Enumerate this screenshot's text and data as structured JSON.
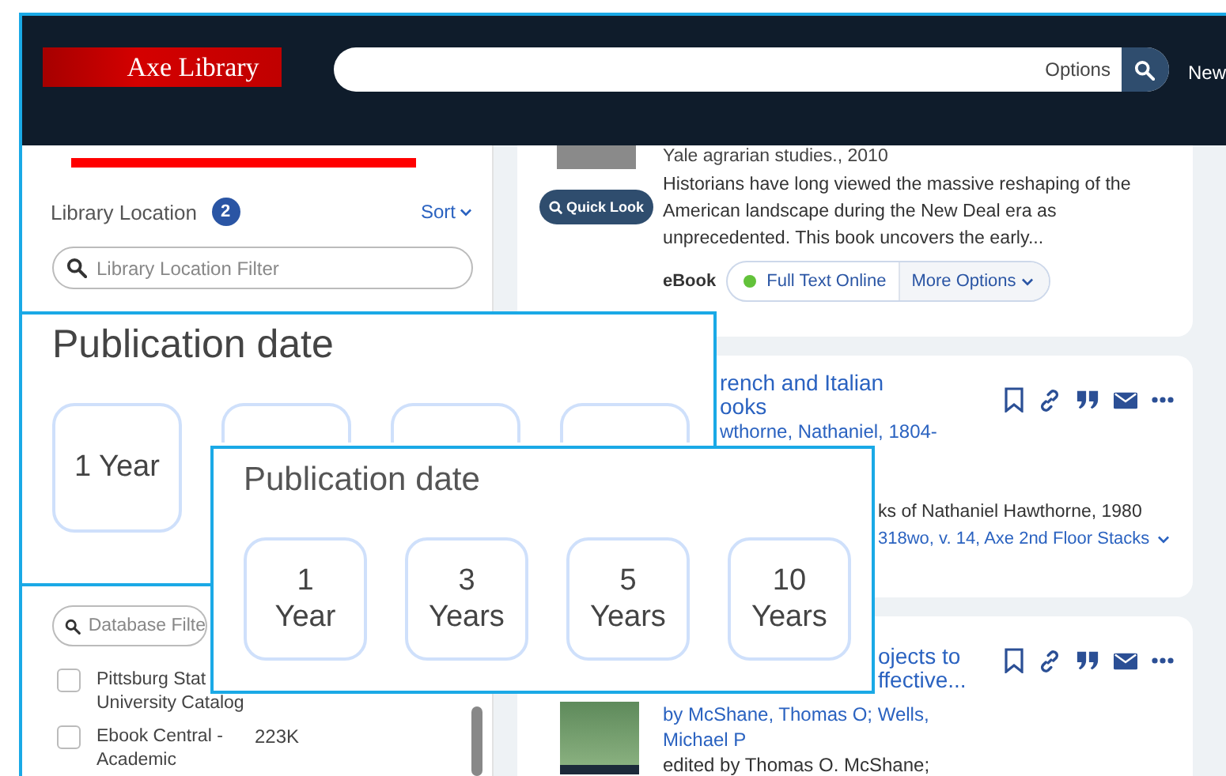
{
  "header": {
    "logo": "Axe Library",
    "search": {
      "options_label": "Options"
    },
    "nav_link": "New"
  },
  "sidebar": {
    "location_facet": {
      "title": "Library Location",
      "count": "2",
      "sort": "Sort",
      "filter_placeholder": "Library Location Filter"
    },
    "database_facet": {
      "filter_placeholder": "Database Filte",
      "items": [
        {
          "label": "Pittsburg Stat\nUniversity Catalog",
          "checked": false
        },
        {
          "label": "Ebook Central -\nAcademic",
          "count": "223K",
          "checked": false
        }
      ]
    }
  },
  "results": [
    {
      "source": "Yale agrarian studies., 2010",
      "quick_look": "Quick Look",
      "description": "Historians have long viewed the massive reshaping of the American landscape during the New Deal era as unprecedented. This book uncovers the early...",
      "format": "eBook",
      "access": "Full Text Online",
      "more": "More Options"
    },
    {
      "title_lines": [
        "rench and Italian",
        "ooks"
      ],
      "author": "wthorne, Nathaniel, 1804-",
      "series": "ks of Nathaniel Hawthorne, 1980",
      "holding": "318wo, v. 14, Axe 2nd Floor Stacks"
    },
    {
      "title_lines": [
        "ojects to",
        "ffective..."
      ],
      "author_lines": [
        "by McShane, Thomas O; Wells,",
        "Michael P"
      ],
      "editor": "edited by Thomas O. McShane;"
    }
  ],
  "overlays": [
    {
      "title": "Publication date",
      "options": [
        {
          "label": "1 Year"
        }
      ]
    },
    {
      "title": "Publication date",
      "options": [
        {
          "number": "1",
          "unit": "Year"
        },
        {
          "number": "3",
          "unit": "Years"
        },
        {
          "number": "5",
          "unit": "Years"
        },
        {
          "number": "10",
          "unit": "Years"
        }
      ]
    }
  ]
}
